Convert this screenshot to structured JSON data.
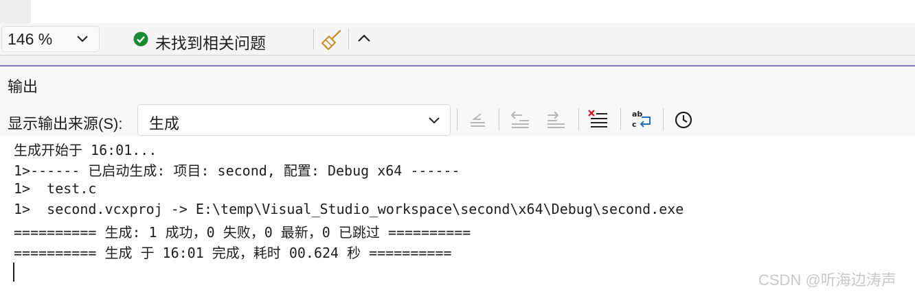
{
  "status_bar": {
    "zoom_value": "146 %",
    "issues_text": "未找到相关问题"
  },
  "output_panel": {
    "title": "输出",
    "source_label": "显示输出来源(S):",
    "source_value": "生成",
    "toolbar_icons": [
      "go-to-previous-message-icon",
      "find-previous-icon",
      "find-next-icon",
      "clear-all-icon",
      "toggle-word-wrap-icon",
      "show-timestamps-icon"
    ],
    "lines": [
      "生成开始于 16:01...",
      "1>------ 已启动生成: 项目: second, 配置: Debug x64 ------",
      "1>  test.c",
      "1>  second.vcxproj -> E:\\temp\\Visual_Studio_workspace\\second\\x64\\Debug\\second.exe",
      "========== 生成: 1 成功，0 失败，0 最新，0 已跳过 ==========",
      "========== 生成 于 16:01 完成，耗时 00.624 秒 =========="
    ]
  },
  "watermark": "CSDN @听海边涛声",
  "colors": {
    "ok_green": "#1b8a36",
    "broom_gold": "#c8902a",
    "clear_red": "#d81e2a",
    "wrap_blue": "#1a73c8",
    "splitter_accent": "#7a7fb8"
  }
}
